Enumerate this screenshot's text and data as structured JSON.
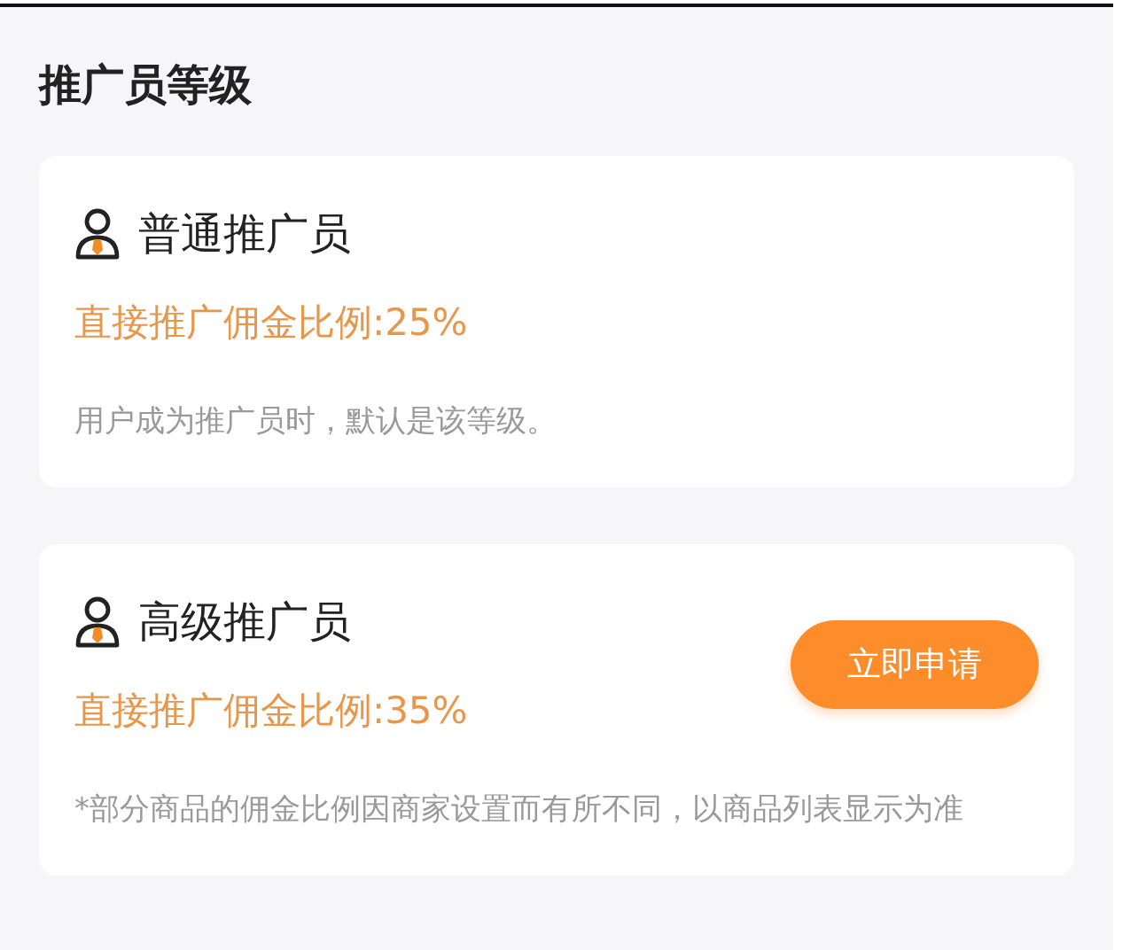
{
  "title": "推广员等级",
  "levels": [
    {
      "name": "普通推广员",
      "rate": "直接推广佣金比例:25%",
      "note": "用户成为推广员时，默认是该等级。"
    },
    {
      "name": "高级推广员",
      "rate": "直接推广佣金比例:35%",
      "note": "*部分商品的佣金比例因商家设置而有所不同，以商品列表显示为准",
      "button": "立即申请"
    }
  ]
}
